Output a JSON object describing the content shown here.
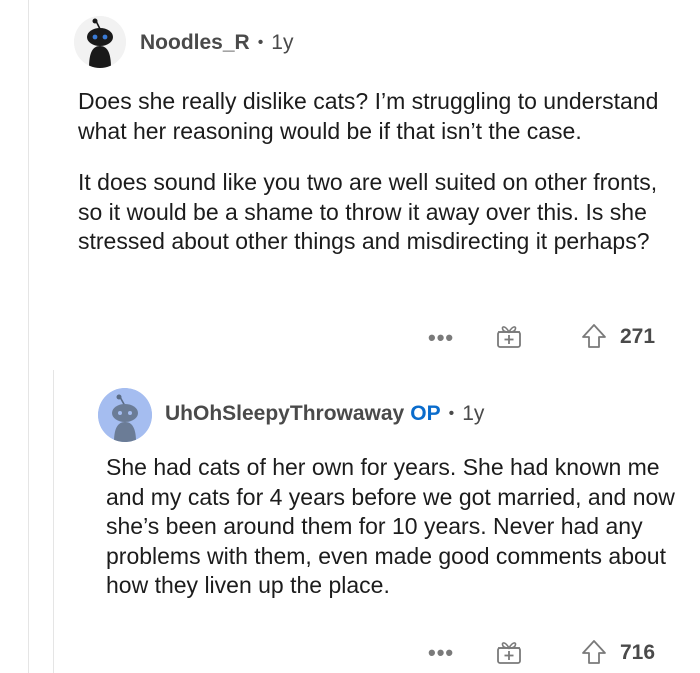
{
  "comments": [
    {
      "username": "Noodles_R",
      "op_badge": "",
      "separator": "•",
      "age": "1y",
      "paragraphs": [
        "Does she really dislike cats? I’m struggling to understand what her reasoning would be if that isn’t the case.",
        "It does sound like you two are well suited on other fronts, so it would be a shame to throw it away over this. Is she stressed about other things and misdirecting it perhaps?"
      ],
      "more_label": "•••",
      "award_icon": "award-icon",
      "upvote_icon": "upvote-icon",
      "score": "271",
      "avatar_color": "#f2f2f2"
    },
    {
      "username": "UhOhSleepyThrowaway",
      "op_badge": "OP",
      "separator": "•",
      "age": "1y",
      "paragraphs": [
        "She had cats of her own for years. She had known me and my cats for 4 years before we got married, and now she’s been around them for 10 years. Never had any problems with them, even made good comments about how they liven up the place."
      ],
      "more_label": "•••",
      "award_icon": "award-icon",
      "upvote_icon": "upvote-icon",
      "score": "716",
      "avatar_color": "#a5bdf0"
    }
  ],
  "colors": {
    "op_badge": "#0a6ccc",
    "text": "#1c1c1c",
    "meta": "#4a4a4a",
    "icon": "#7a7a7a",
    "thread_line": "#e5e5e5"
  }
}
